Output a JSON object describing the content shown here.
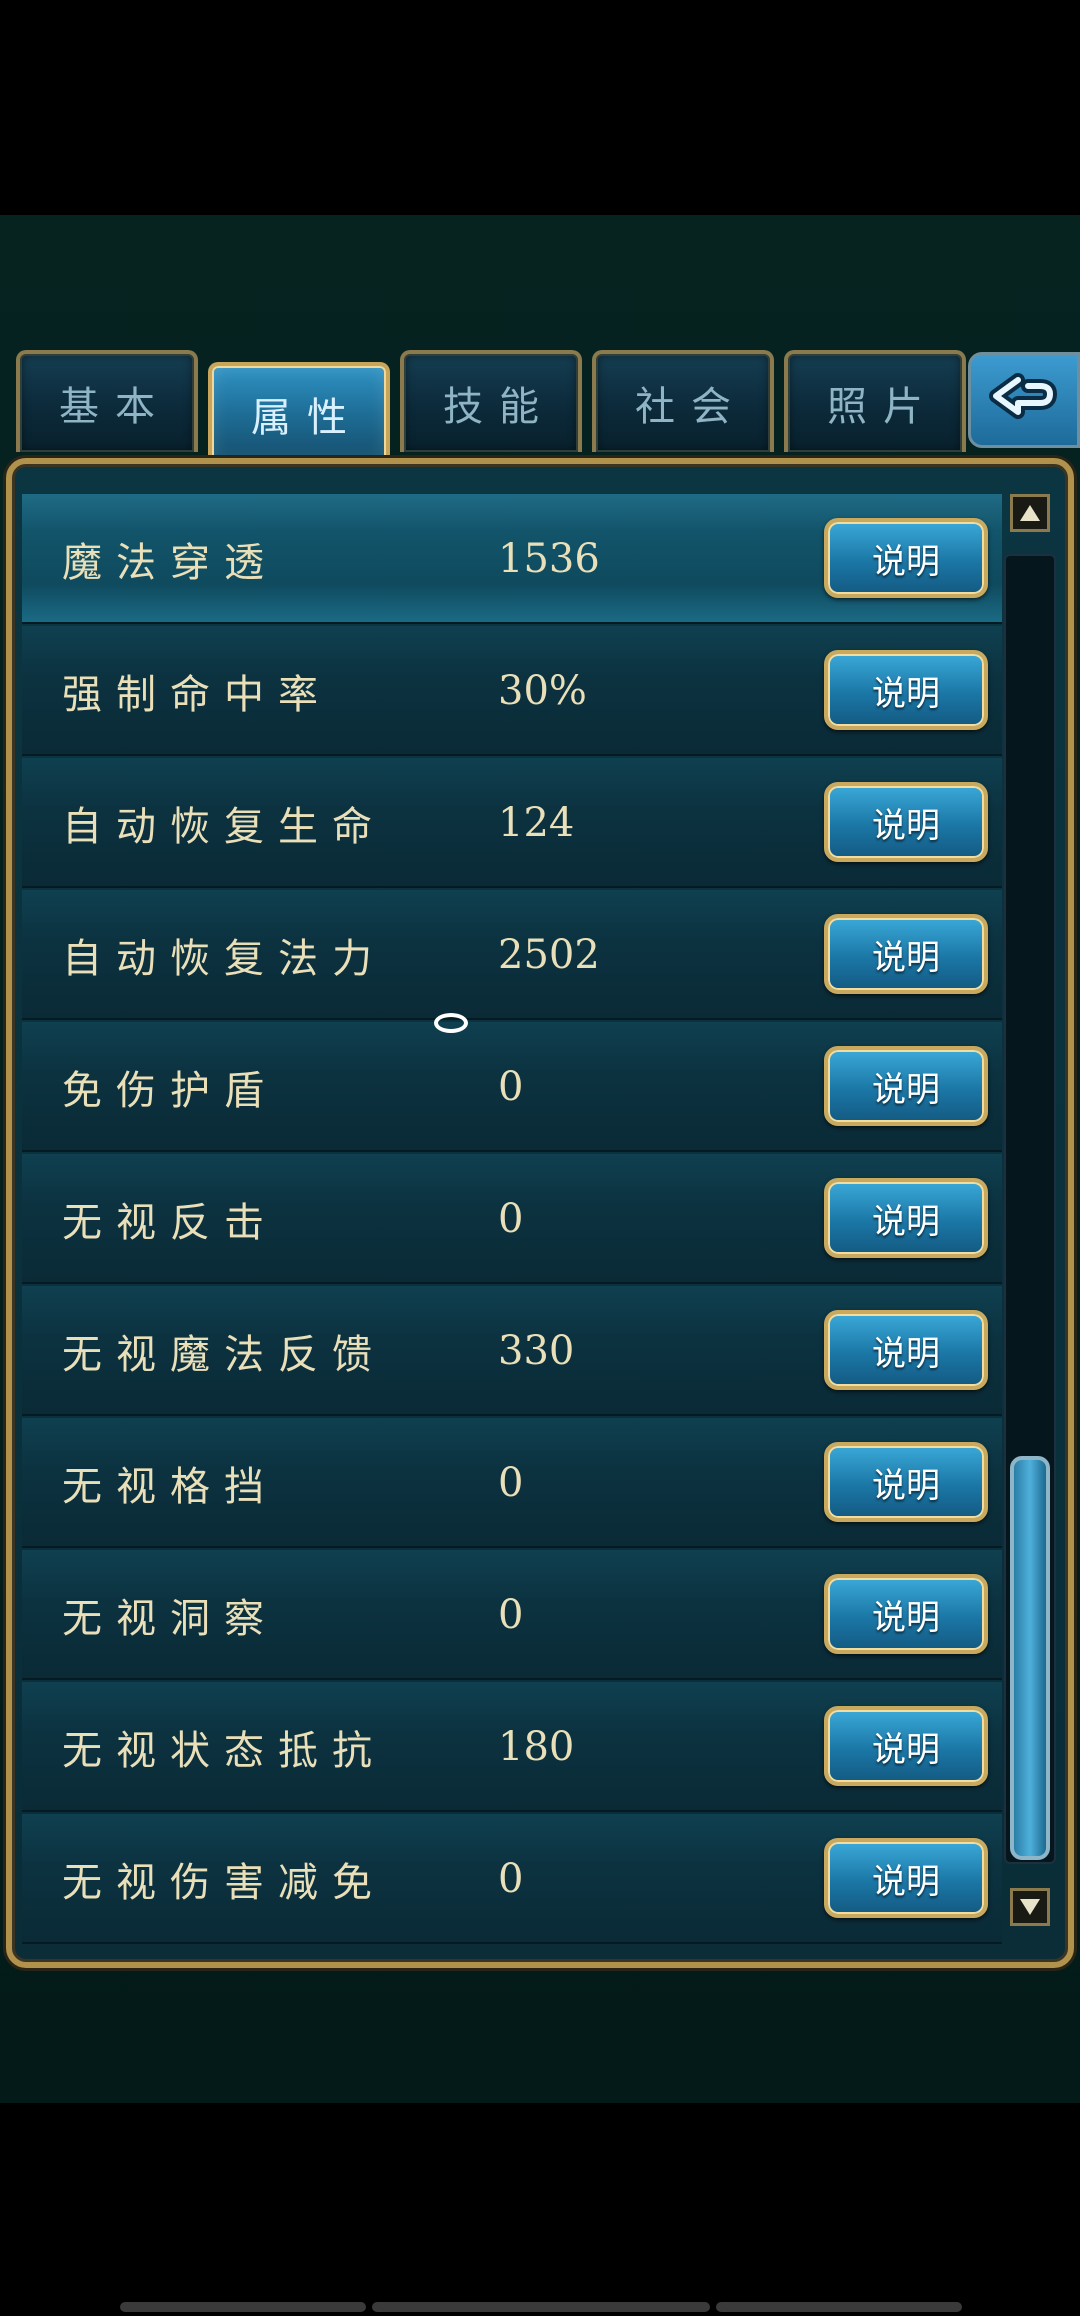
{
  "tabs": [
    {
      "label": "基本",
      "active": false
    },
    {
      "label": "属性",
      "active": true
    },
    {
      "label": "技能",
      "active": false
    },
    {
      "label": "社会",
      "active": false
    },
    {
      "label": "照片",
      "active": false
    }
  ],
  "back_icon": "return-arrow-icon",
  "explain_label": "说明",
  "attributes": [
    {
      "name": "魔法穿透",
      "value": "1536",
      "selected": true
    },
    {
      "name": "强制命中率",
      "value": "30%",
      "selected": false
    },
    {
      "name": "自动恢复生命",
      "value": "124",
      "selected": false
    },
    {
      "name": "自动恢复法力",
      "value": "2502",
      "selected": false
    },
    {
      "name": "免伤护盾",
      "value": "0",
      "selected": false
    },
    {
      "name": "无视反击",
      "value": "0",
      "selected": false
    },
    {
      "name": "无视魔法反馈",
      "value": "330",
      "selected": false
    },
    {
      "name": "无视格挡",
      "value": "0",
      "selected": false
    },
    {
      "name": "无视洞察",
      "value": "0",
      "selected": false
    },
    {
      "name": "无视状态抵抗",
      "value": "180",
      "selected": false
    },
    {
      "name": "无视伤害减免",
      "value": "0",
      "selected": false
    }
  ],
  "colors": {
    "gold_frame": "#b1924d",
    "active_tab": "#2f93c4",
    "text": "#e9dfb8",
    "button": "#1b77a6"
  }
}
